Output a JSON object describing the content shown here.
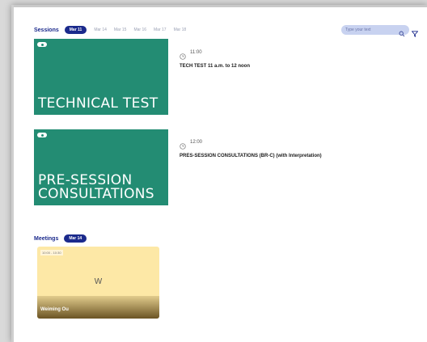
{
  "sessions": {
    "title": "Sessions",
    "active_day": "Mar 11",
    "days": [
      "Mar 14",
      "Mar 15",
      "Mar 16",
      "Mar 17",
      "Mar 18"
    ],
    "search_placeholder": "Type your text",
    "items": [
      {
        "thumb_title": "TECHNICAL TEST",
        "time": "11:00",
        "title": "TECH TEST 11 a.m. to 12 noon"
      },
      {
        "thumb_title": "PRE-SESSION\nCONSULTATIONS",
        "time": "12:00",
        "title": "PRES-SESSION CONSULTATIONS (BR-C) (with Interpretation)"
      }
    ]
  },
  "meetings": {
    "title": "Meetings",
    "active_day": "Mar 14",
    "items": [
      {
        "time": "10:00 - 10:30",
        "initial": "W",
        "name": "Weiming Ou"
      }
    ]
  },
  "colors": {
    "brand": "#1b2a8c",
    "session_card": "#238c73",
    "meeting_card": "#fde8a6"
  }
}
